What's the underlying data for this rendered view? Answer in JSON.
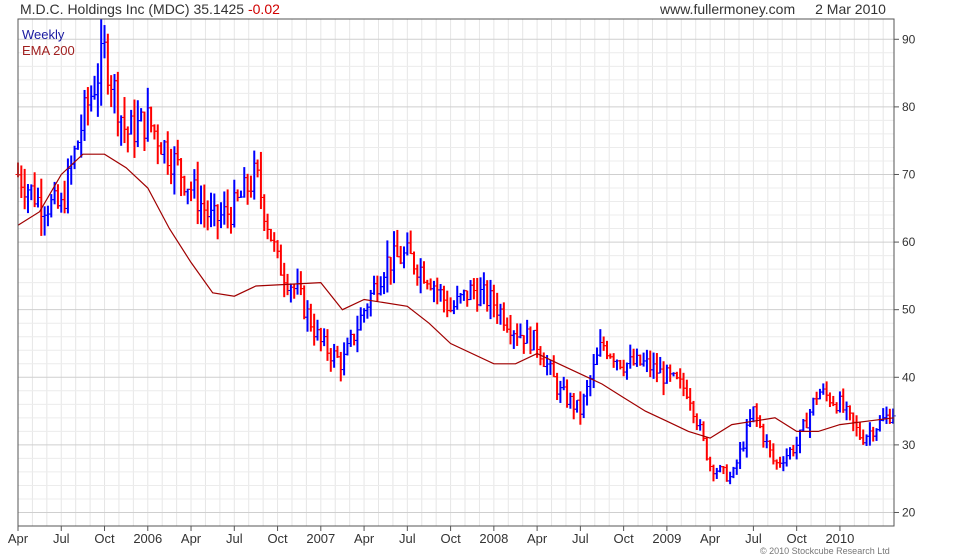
{
  "header": {
    "title": "M.D.C. Holdings Inc (MDC)",
    "price": "35.1425",
    "change": "-0.02",
    "site": "www.fullermoney.com",
    "date": "2 Mar 2010"
  },
  "copyright": "© 2010 Stockcube Research Ltd",
  "colors": {
    "up": "#0000ff",
    "down": "#ff0000",
    "ema": "#a00000",
    "grid": "#d9d9d9",
    "frame": "#555555"
  },
  "chart_data": {
    "type": "line",
    "title": "M.D.C. Holdings Inc (MDC)",
    "xlabel": "",
    "ylabel": "",
    "ylim": [
      18,
      93
    ],
    "grid": true,
    "legend_position": "top-left",
    "y_ticks": [
      20,
      30,
      40,
      50,
      60,
      70,
      80,
      90
    ],
    "x_ticks": [
      "Apr",
      "Jul",
      "Oct",
      "2006",
      "Apr",
      "Jul",
      "Oct",
      "2007",
      "Apr",
      "Jul",
      "Oct",
      "2008",
      "Apr",
      "Jul",
      "Oct",
      "2009",
      "Apr",
      "Jul",
      "Oct",
      "2010"
    ],
    "legend": [
      "Weekly",
      "EMA 200"
    ],
    "x": [
      0,
      0.5,
      1,
      1.5,
      2,
      2.5,
      3,
      3.5,
      4,
      4.5,
      5,
      5.5,
      6,
      6.5,
      7,
      7.5,
      8,
      8.5,
      9,
      9.5,
      10,
      10.5,
      11,
      11.5,
      12,
      12.5,
      13,
      13.5,
      14,
      14.5,
      15,
      15.5,
      16,
      16.5,
      17,
      17.5,
      18,
      18.5,
      19,
      19.5,
      20.25
    ],
    "series": [
      {
        "name": "Weekly",
        "values": [
          70,
          66,
          65,
          78,
          88,
          76,
          78,
          73,
          68,
          63,
          65,
          70,
          57,
          52,
          45,
          42,
          50,
          57,
          58,
          55,
          50,
          53,
          51,
          47,
          45,
          38,
          35,
          45,
          42,
          42,
          40,
          38,
          27,
          25,
          35,
          27,
          30,
          38,
          36,
          31,
          35
        ]
      },
      {
        "name": "EMA 200",
        "values": [
          62.5,
          64.5,
          70,
          73,
          73,
          71,
          68,
          62,
          57,
          52.5,
          52,
          53.5,
          54,
          50,
          51.5,
          50.5,
          48,
          45,
          42,
          42,
          43.5,
          42,
          40.5,
          39,
          37,
          35,
          33.5,
          32,
          31,
          33,
          33.5,
          34,
          32,
          32,
          33,
          34
        ]
      }
    ],
    "ema_x": [
      0,
      0.5,
      1,
      1.5,
      2,
      2.5,
      3,
      3.5,
      4,
      4.5,
      5,
      5.5,
      7,
      7.5,
      8,
      9,
      9.5,
      10,
      11,
      11.5,
      12,
      12.5,
      13,
      13.5,
      14,
      14.5,
      15,
      15.5,
      16,
      16.5,
      17,
      17.5,
      18,
      18.5,
      19,
      20.25
    ]
  }
}
